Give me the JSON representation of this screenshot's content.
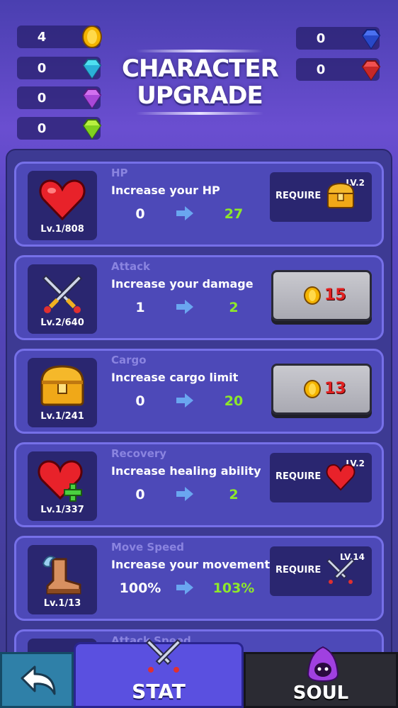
{
  "resources": {
    "gold": "4",
    "cyan_gem": "0",
    "purple_gem": "0",
    "green_gem": "0",
    "blue_gem": "0",
    "red_gem": "0"
  },
  "title_line1": "CHARACTER",
  "title_line2": "UPGRADE",
  "cards": [
    {
      "name": "HP",
      "desc": "Increase your HP",
      "from": "0",
      "to": "27",
      "level": "Lv.1/808",
      "icon": "heart-icon",
      "require_label": "REQUIRE",
      "require_level": "LV.2",
      "require_icon": "chest-icon"
    },
    {
      "name": "Attack",
      "desc": "Increase your damage",
      "from": "1",
      "to": "2",
      "level": "Lv.2/640",
      "icon": "crossed-swords-icon",
      "cost": "15"
    },
    {
      "name": "Cargo",
      "desc": "Increase cargo limit",
      "from": "0",
      "to": "20",
      "level": "Lv.1/241",
      "icon": "chest-icon",
      "cost": "13"
    },
    {
      "name": "Recovery",
      "desc": "Increase healing ability",
      "from": "0",
      "to": "2",
      "level": "Lv.1/337",
      "icon": "heart-plus-icon",
      "require_label": "REQUIRE",
      "require_level": "LV.2",
      "require_icon": "heart-icon"
    },
    {
      "name": "Move Speed",
      "desc": "Increase your movement",
      "from": "100%",
      "to": "103%",
      "level": "Lv.1/13",
      "icon": "winged-boot-icon",
      "require_label": "REQUIRE",
      "require_level": "LV.14",
      "require_icon": "crossed-swords-icon"
    }
  ],
  "partial_card_name": "Attack Speed",
  "tabs": {
    "stat": "STAT",
    "soul": "SOUL"
  },
  "colors": {
    "accent_green": "#8ee82a",
    "cost_red": "#e02020",
    "card_bg": "#4d49b8",
    "card_border": "#7670e8"
  }
}
